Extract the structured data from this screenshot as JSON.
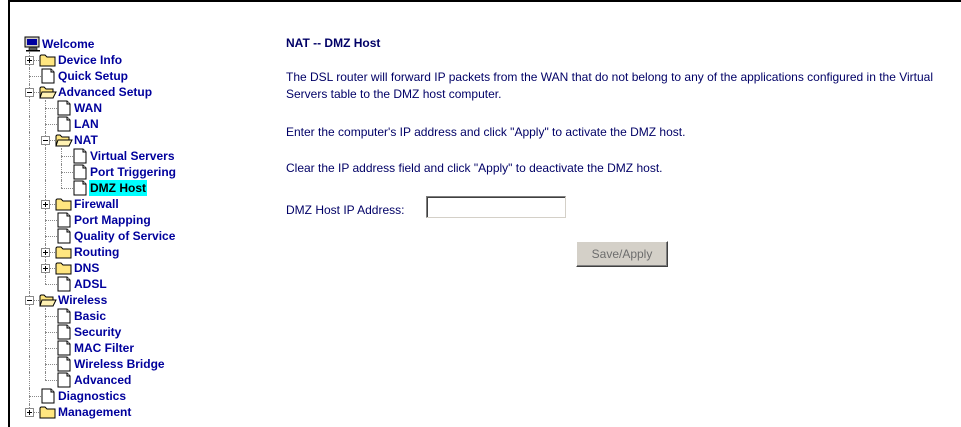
{
  "nav": {
    "welcome": "Welcome",
    "device_info": "Device Info",
    "quick_setup": "Quick Setup",
    "advanced_setup": "Advanced Setup",
    "wan": "WAN",
    "lan": "LAN",
    "nat": "NAT",
    "virtual_servers": "Virtual Servers",
    "port_triggering": "Port Triggering",
    "dmz_host": "DMZ Host",
    "firewall": "Firewall",
    "port_mapping": "Port Mapping",
    "quality_of_service": "Quality of Service",
    "routing": "Routing",
    "dns": "DNS",
    "adsl": "ADSL",
    "wireless": "Wireless",
    "basic": "Basic",
    "security": "Security",
    "mac_filter": "MAC Filter",
    "wireless_bridge": "Wireless Bridge",
    "advanced": "Advanced",
    "diagnostics": "Diagnostics",
    "management": "Management",
    "selected_item": "DMZ Host"
  },
  "main": {
    "title": "NAT -- DMZ Host",
    "description": "The DSL router will forward IP packets from the WAN that do not belong to any of the applications configured in the Virtual Servers table to the DMZ host computer.",
    "instruction_activate": "Enter the computer's IP address and click \"Apply\" to activate the DMZ host.",
    "instruction_deactivate": "Clear the IP address field and click \"Apply\" to deactivate the DMZ host.",
    "dmz_ip_label": "DMZ Host IP Address:",
    "dmz_ip_value": "",
    "save_apply_label": "Save/Apply"
  },
  "colors": {
    "nav_text": "#00009c",
    "content_text": "#000066",
    "selected_highlight": "#00ffff",
    "folder_yellow": "#ffe680",
    "button_face": "#d4d0c8"
  }
}
